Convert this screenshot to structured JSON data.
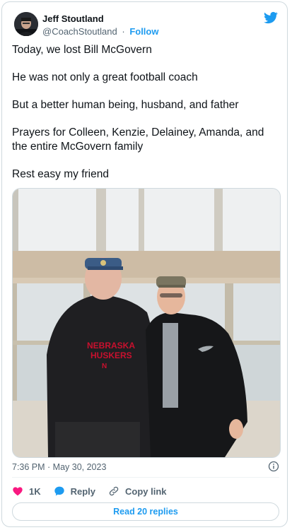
{
  "author": {
    "display_name": "Jeff Stoutland",
    "handle": "@CoachStoutland",
    "separator": "·",
    "follow_label": "Follow"
  },
  "tweet": {
    "paragraphs": [
      "Today, we lost Bill McGovern",
      "He was not only a great football coach",
      "But a better human being, husband, and father",
      "Prayers for Colleen, Kenzie, Delainey, Amanda, and the entire McGovern family",
      "Rest easy my friend"
    ],
    "photo_text": {
      "shirt_line1": "NEBRASKA",
      "shirt_line2": "HUSKERS"
    },
    "timestamp": "7:36 PM · May 30, 2023"
  },
  "actions": {
    "like_count": "1K",
    "reply_label": "Reply",
    "copy_link_label": "Copy link",
    "read_replies_label": "Read 20 replies"
  },
  "colors": {
    "twitter_blue": "#1d9bf0",
    "like_pink": "#f91880",
    "text_primary": "#0f1419",
    "text_secondary": "#536471",
    "border": "#cfd9de"
  },
  "icons": [
    "twitter-bird-icon",
    "info-icon",
    "heart-icon",
    "reply-bubble-icon",
    "link-icon"
  ]
}
